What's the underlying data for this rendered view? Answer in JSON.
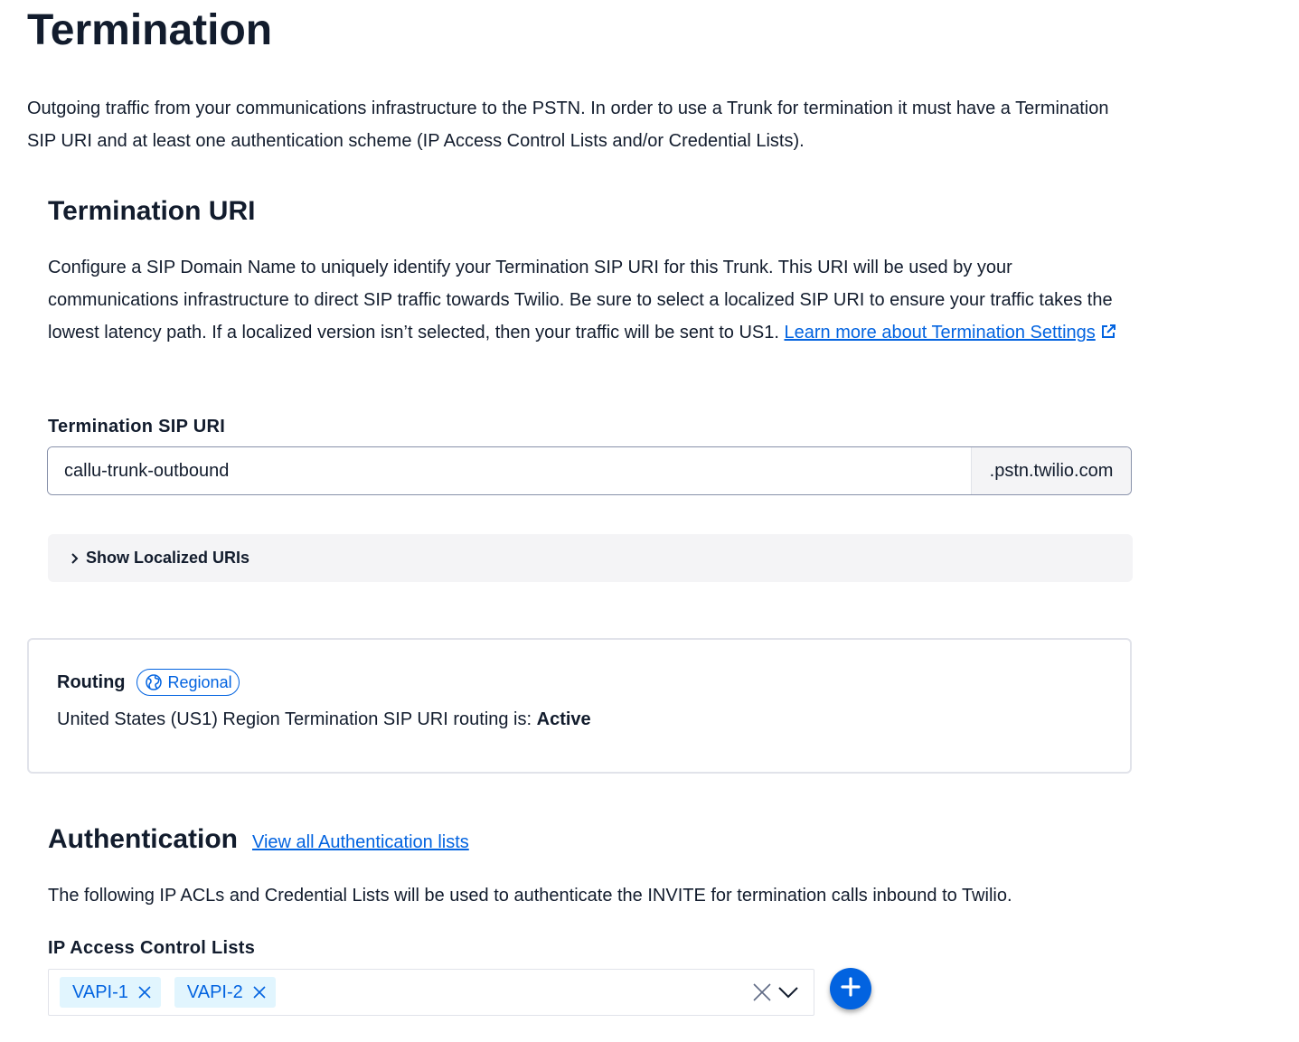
{
  "page": {
    "title": "Termination",
    "intro": "Outgoing traffic from your communications infrastructure to the PSTN. In order to use a Trunk for termination it must have a Termination SIP URI and at least one authentication scheme (IP Access Control Lists and/or Credential Lists)."
  },
  "termination_uri": {
    "heading": "Termination URI",
    "description": "Configure a SIP Domain Name to uniquely identify your Termination SIP URI for this Trunk. This URI will be used by your communications infrastructure to direct SIP traffic towards Twilio. Be sure to select a localized SIP URI to ensure your traffic takes the lowest latency path. If a localized version isn’t selected, then your traffic will be sent to US1. ",
    "learn_more_link": "Learn more about Termination Settings",
    "external_icon": "external-link-icon",
    "sip_uri_label": "Termination SIP URI",
    "sip_uri_value": "callu-trunk-outbound",
    "sip_uri_suffix": ".pstn.twilio.com",
    "show_localized_label": "Show Localized URIs"
  },
  "routing": {
    "title": "Routing",
    "badge_label": "Regional",
    "badge_icon": "globe-icon",
    "status_prefix": "United States (US1) Region Termination SIP URI routing is: ",
    "status_value": "Active"
  },
  "authentication": {
    "heading": "Authentication",
    "view_all_link": "View all Authentication lists",
    "description": "The following IP ACLs and Credential Lists will be used to authenticate the INVITE for termination calls inbound to Twilio.",
    "ip_acl_label": "IP Access Control Lists",
    "ip_acl_selected": [
      "VAPI-1",
      "VAPI-2"
    ]
  },
  "colors": {
    "link": "#0263e0",
    "text": "#121c2d",
    "tag_bg": "#e1f5fe",
    "add_button": "#0263e0"
  }
}
